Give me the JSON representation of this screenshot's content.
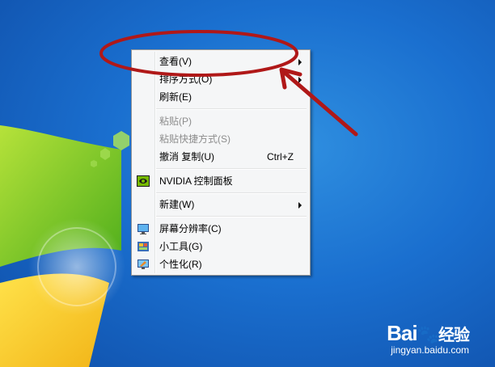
{
  "menu": {
    "items": [
      {
        "label": "查看(V)",
        "has_submenu": true,
        "enabled": true
      },
      {
        "label": "排序方式(O)",
        "has_submenu": true,
        "enabled": true
      },
      {
        "label": "刷新(E)",
        "enabled": true
      },
      {
        "label": "粘贴(P)",
        "enabled": false
      },
      {
        "label": "粘贴快捷方式(S)",
        "enabled": false
      },
      {
        "label": "撤消 复制(U)",
        "shortcut": "Ctrl+Z",
        "enabled": true
      },
      {
        "label": "NVIDIA 控制面板",
        "icon": "nvidia-icon",
        "enabled": true
      },
      {
        "label": "新建(W)",
        "has_submenu": true,
        "enabled": true
      },
      {
        "label": "屏幕分辨率(C)",
        "icon": "monitor-icon",
        "enabled": true
      },
      {
        "label": "小工具(G)",
        "icon": "gadgets-icon",
        "enabled": true
      },
      {
        "label": "个性化(R)",
        "icon": "personalize-icon",
        "enabled": true
      }
    ]
  },
  "watermark": {
    "brand": "Bai",
    "brand_suffix": "经验",
    "url": "jingyan.baidu.com"
  },
  "colors": {
    "desktop_blue": "#1a6fcf",
    "annotation_red": "#b01818",
    "menu_bg": "#f5f6f7"
  }
}
